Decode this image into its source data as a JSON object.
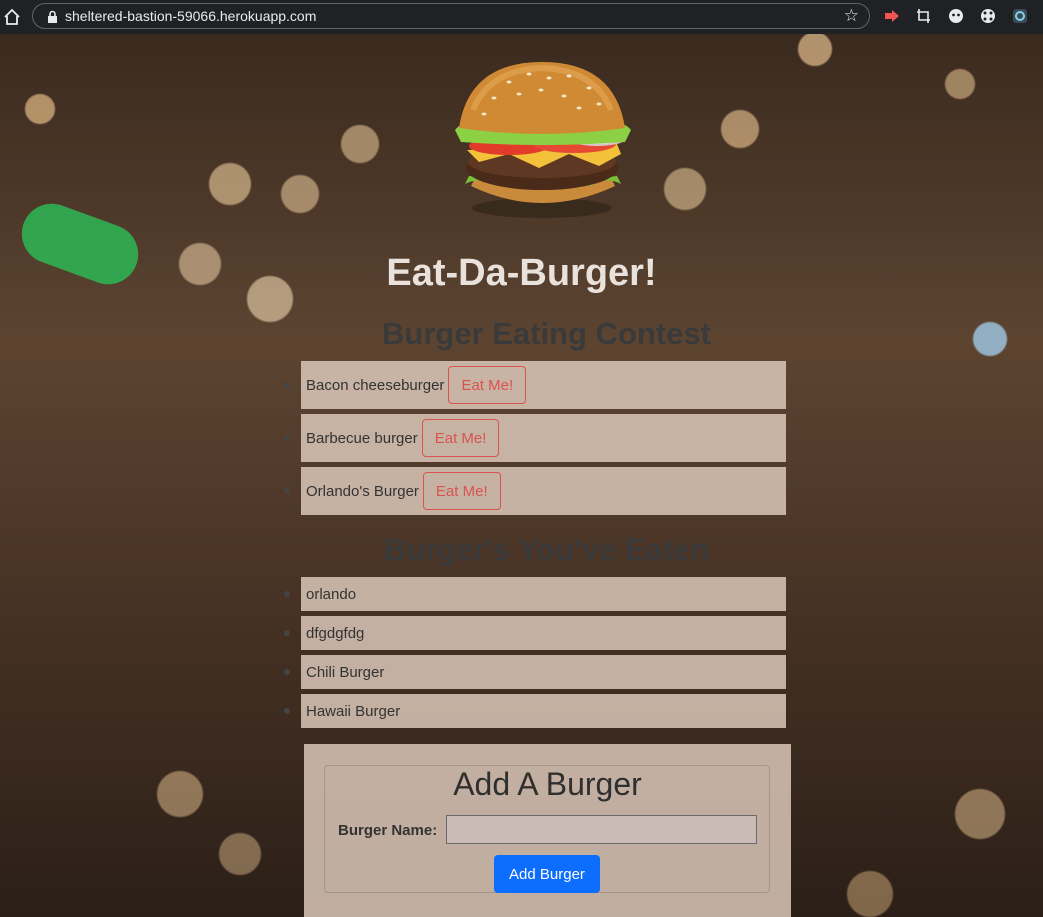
{
  "browser": {
    "url": "sheltered-bastion-59066.herokuapp.com"
  },
  "page": {
    "title": "Eat-Da-Burger!",
    "contest_heading": "Burger Eating Contest",
    "eaten_heading": "Burger's You've Eaten",
    "contest_items": [
      {
        "name": "Bacon cheeseburger",
        "button": "Eat Me!"
      },
      {
        "name": "Barbecue burger",
        "button": "Eat Me!"
      },
      {
        "name": "Orlando's Burger",
        "button": "Eat Me!"
      }
    ],
    "eaten_items": [
      "orlando",
      "dfgdgfdg",
      "Chili Burger",
      "Hawaii Burger"
    ],
    "form": {
      "title": "Add A Burger",
      "label": "Burger Name:",
      "input_value": "",
      "submit": "Add Burger"
    }
  }
}
